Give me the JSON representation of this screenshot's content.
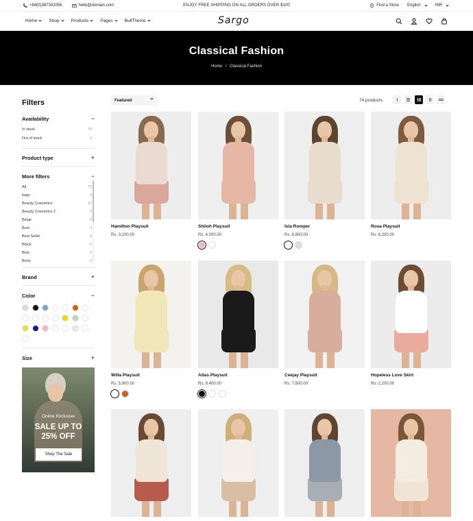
{
  "topbar": {
    "phone": "+84(0)387392056",
    "email": "hello@domain.com",
    "announcement": "ENJOY FREE SHIPPING ON ALL ORDERS OVER $100",
    "find_store": "Find a Store",
    "language": "English",
    "currency": "INR"
  },
  "nav": {
    "logo": "Sargo",
    "menu": [
      "Home",
      "Shop",
      "Products",
      "Pages",
      "BullTheme"
    ],
    "icons": [
      "search-icon",
      "account-icon",
      "wishlist-icon",
      "cart-icon"
    ]
  },
  "hero": {
    "title": "Classical Fashion",
    "breadcrumb_home": "Home",
    "breadcrumb_sep": "/",
    "breadcrumb_current": "Classical Fashion"
  },
  "filters": {
    "title": "Filters",
    "availability": {
      "label": "Availability",
      "items": [
        {
          "label": "In stock",
          "count": "74"
        },
        {
          "label": "Out of stock",
          "count": "0"
        }
      ]
    },
    "product_type": {
      "label": "Product type"
    },
    "more_filters": {
      "label": "More filters",
      "items": [
        {
          "label": "All",
          "count": "73"
        },
        {
          "label": "bags",
          "count": "3"
        },
        {
          "label": "Beauty Cosmetics",
          "count": "12"
        },
        {
          "label": "Beauty Cosmetics 2",
          "count": "6"
        },
        {
          "label": "Beige",
          "count": "9"
        },
        {
          "label": "Best",
          "count": "3"
        },
        {
          "label": "Best Seller",
          "count": "5"
        },
        {
          "label": "Black",
          "count": "6"
        },
        {
          "label": "Blue",
          "count": "3"
        },
        {
          "label": "Boho",
          "count": "3"
        }
      ]
    },
    "brand": {
      "label": "Brand"
    },
    "color": {
      "label": "Color",
      "swatches": [
        "#dddddd",
        "#111111",
        "#7ea3cf",
        "#ffffff",
        "#ffffff",
        "#c8631e",
        "#ffffff",
        "#ffffff",
        "#ffffff",
        "#ffffff",
        "#ffffff",
        "#f2d31b",
        "#b8d9b0",
        "#ffffff",
        "#e8e049",
        "#1b1f7a",
        "#f4b3c8",
        "#ffffff",
        "#ffffff",
        "#e6e6e6",
        "#ffffff",
        "#ffffff"
      ]
    },
    "size": {
      "label": "Size"
    }
  },
  "promo": {
    "subtitle": "Online Exclusive",
    "headline_1": "SALE UP TO",
    "headline_2": "25% OFF",
    "button": "Shop The Sale"
  },
  "toolbar": {
    "sort_selected": "Featured",
    "product_count": "74 products"
  },
  "products": [
    {
      "name": "Hamilton Playsuit",
      "price": "Rs. 3,100.00",
      "swatches": [],
      "outfit": "#eadbd2",
      "accent": "#d9a79b",
      "hair": "#8a6a4f",
      "bg": "#ededed"
    },
    {
      "name": "Shiloh Playsuit",
      "price": "Rs. 4,000.00",
      "swatches": [
        "#f1b8b7",
        "#ffffff"
      ],
      "outfit": "#e7b7a6",
      "accent": "#e7b7a6",
      "hair": "#6d4e38",
      "bg": "#efefef"
    },
    {
      "name": "Isla Romper",
      "price": "Rs. 8,800.00",
      "swatches": [
        "#ffffff",
        "#e0ddd5"
      ],
      "outfit": "#e8dccd",
      "accent": "#e8dccd",
      "hair": "#5d4330",
      "bg": "#eeeeee"
    },
    {
      "name": "Rosa Playsuit",
      "price": "Rs. 6,200.00",
      "swatches": [],
      "outfit": "#eee3d1",
      "accent": "#eee3d1",
      "hair": "#7e5a3e",
      "bg": "#ededed"
    },
    {
      "name": "Willa Playsuit",
      "price": "Rs. 5,900.00",
      "swatches": [
        "#ffffff",
        "#c8631e"
      ],
      "outfit": "#f1e6b8",
      "accent": "#f1e6b8",
      "hair": "#c9a46c",
      "bg": "#f3f2ee"
    },
    {
      "name": "Atlas Playsuit",
      "price": "Rs. 8,400.00",
      "swatches": [
        "#111111",
        "#ffffff",
        "#ffffff"
      ],
      "outfit": "#1a1a1a",
      "accent": "#1a1a1a",
      "hair": "#d7bb85",
      "bg": "#e9e9e9"
    },
    {
      "name": "Ceejay Playsuit",
      "price": "Rs. 7,500.00",
      "swatches": [],
      "outfit": "#d9ad9d",
      "accent": "#d9ad9d",
      "hair": "#d6b986",
      "bg": "#f1f1f1"
    },
    {
      "name": "Hopeless Love Skirt",
      "price": "Rs. 2,200.00",
      "swatches": [],
      "outfit": "#ffffff",
      "accent": "#e9ab9c",
      "hair": "#6e4b33",
      "bg": "#ececec"
    },
    {
      "name": "",
      "price": "",
      "swatches": [],
      "outfit": "#f0e6d8",
      "accent": "#b85a4e",
      "hair": "#6a4a34",
      "bg": "#eeeeee"
    },
    {
      "name": "",
      "price": "",
      "swatches": [],
      "outfit": "#f4efe8",
      "accent": "#d8bfa4",
      "hair": "#cfae7b",
      "bg": "#efefef"
    },
    {
      "name": "",
      "price": "",
      "swatches": [],
      "outfit": "#8d98a6",
      "accent": "#a9aeb5",
      "hair": "#5e4431",
      "bg": "#eeeeee"
    },
    {
      "name": "",
      "price": "",
      "swatches": [],
      "outfit": "#f4ece0",
      "accent": "#f0e4d4",
      "hair": "#7a5739",
      "bg": "#e6b7a3"
    }
  ]
}
